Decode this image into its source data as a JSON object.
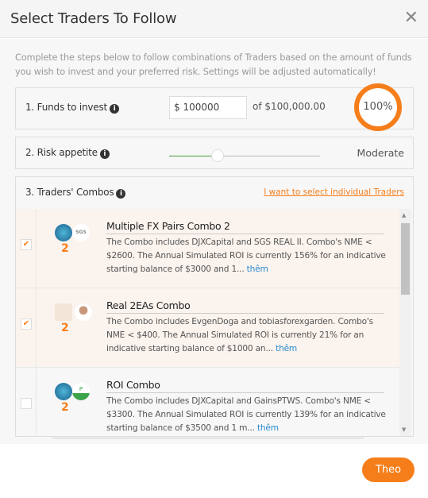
{
  "header": {
    "title": "Select Traders To Follow",
    "close_icon": "close-icon"
  },
  "intro": "Complete the steps below to follow combinations of Traders based on the amount of funds you wish to invest and your preferred risk. Settings will be adjusted automatically!",
  "funds": {
    "label": "1. Funds to invest",
    "value": "$ 100000",
    "of_text": "of $100,000.00",
    "percent_label": "100%",
    "percent": 100
  },
  "risk": {
    "label": "2. Risk appetite",
    "value_label": "Moderate",
    "slider_fraction": 0.32
  },
  "combos": {
    "label": "3. Traders' Combos",
    "link": "I want to select individual Traders",
    "items": [
      {
        "name": "Multiple FX Pairs Combo 2",
        "count": "2",
        "checked": true,
        "desc": "The Combo includes DJXCapital and SGS REAL II. Combo's NME < $2600. The Annual Simulated ROI is currently 156% for an indicative starting balance of $3000 and 1...",
        "more": "thêm",
        "avatar2": "SGS"
      },
      {
        "name": "Real 2EAs Combo",
        "count": "2",
        "checked": true,
        "desc": "The Combo includes EvgenDoga and tobiasforexgarden. Combo's NME < $400. The Annual Simulated ROI is currently 21% for an indicative starting balance of $1000 an...",
        "more": "thêm",
        "avatar2": ""
      },
      {
        "name": "ROI Combo",
        "count": "2",
        "checked": false,
        "desc": "The Combo includes DJXCapital and GainsPTWS. Combo's NME < $3300. The Annual Simulated ROI is currently 139% for an indicative starting balance of $3500 and 1 m...",
        "more": "thêm",
        "avatar2": "P"
      }
    ]
  },
  "footer": {
    "next_button": "Theo"
  },
  "colors": {
    "accent": "#f57e1b",
    "link": "#2a8bd0",
    "slider_fill": "#4a9a3a"
  }
}
